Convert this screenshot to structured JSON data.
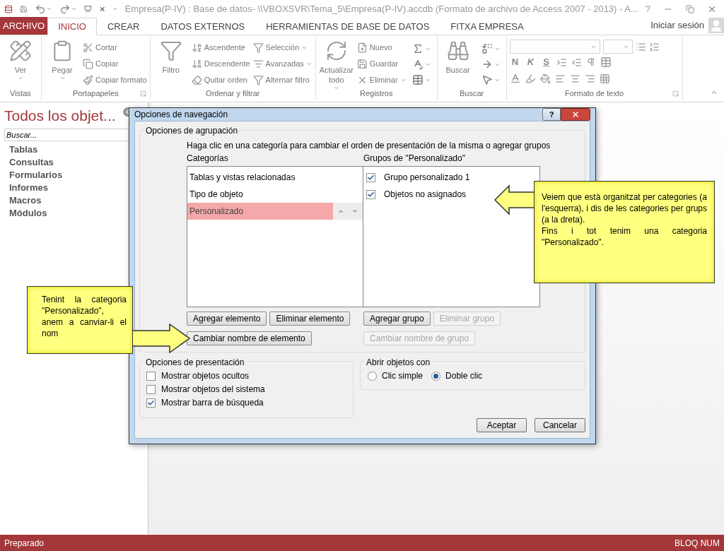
{
  "title_bar": {
    "title": "Empresa(P-IV) : Base de datos- \\\\VBOXSVR\\Tema_5\\Empresa(P-IV).accdb (Formato de archivo de Access 2007 - 2013) - A...",
    "help": "?"
  },
  "tabs": [
    {
      "label": "ARCHIVO",
      "kind": "file",
      "selected": false
    },
    {
      "label": "INICIO",
      "kind": "tab",
      "selected": true
    },
    {
      "label": "CREAR",
      "kind": "tab",
      "selected": false
    },
    {
      "label": "DATOS EXTERNOS",
      "kind": "tab",
      "selected": false
    },
    {
      "label": "HERRAMIENTAS DE BASE DE DATOS",
      "kind": "tab",
      "selected": false
    },
    {
      "label": "FITXA EMPRESA",
      "kind": "tab",
      "selected": false
    }
  ],
  "account": "Iniciar sesión",
  "ribbon": [
    {
      "label": "Vistas",
      "large": [
        {
          "label": "Ver",
          "dropdown": true
        }
      ]
    },
    {
      "label": "Portapapeles",
      "launcher": true,
      "large": [
        {
          "label": "Pegar",
          "dropdown": true
        }
      ],
      "columns": [
        [
          {
            "label": "Cortar",
            "dropdown": false
          },
          {
            "label": "Copiar",
            "dropdown": false
          },
          {
            "label": "Copiar formato",
            "dropdown": false
          }
        ]
      ]
    },
    {
      "label": "Ordenar y filtrar",
      "large": [
        {
          "label": "Filtro",
          "dropdown": false
        }
      ],
      "columns": [
        [
          {
            "label": "Ascendente",
            "dropdown": false
          },
          {
            "label": "Descendente",
            "dropdown": false
          },
          {
            "label": "Quitar orden",
            "dropdown": false
          }
        ],
        [
          {
            "label": "Selección",
            "dropdown": true
          },
          {
            "label": "Avanzadas",
            "dropdown": true
          },
          {
            "label": "Alternar filtro",
            "dropdown": false
          }
        ]
      ]
    },
    {
      "label": "Registros",
      "large": [
        {
          "label": "Actualizar todo",
          "dropdown": true
        }
      ],
      "columns": [
        [
          {
            "label": "Nuevo",
            "dropdown": false
          },
          {
            "label": "Guardar",
            "dropdown": false
          },
          {
            "label": "Eliminar",
            "dropdown": true
          }
        ]
      ]
    },
    {
      "label": "Buscar",
      "large": [
        {
          "label": "Buscar",
          "dropdown": false
        }
      ]
    },
    {
      "label": "Formato de texto",
      "launcher": true,
      "format_buttons": [
        "N",
        "K",
        "S"
      ]
    }
  ],
  "nav_pane": {
    "title": "Todos los objet...",
    "search_placeholder": "Buscar...",
    "items": [
      "Tablas",
      "Consultas",
      "Formularios",
      "Informes",
      "Macros",
      "Módulos"
    ]
  },
  "dialog": {
    "title": "Opciones de navegación",
    "help": "?",
    "grouping": {
      "legend": "Opciones de agrupación",
      "instruction": "Haga clic en una categoría para cambiar el orden de presentación de la misma o agregar grupos",
      "categories_label": "Categorías",
      "groups_label": "Grupos de \"Personalizado\"",
      "categories": [
        {
          "label": "Tablas y vistas relacionadas",
          "selected": false
        },
        {
          "label": "Tipo de objeto",
          "selected": false
        },
        {
          "label": "Personalizado",
          "selected": true
        }
      ],
      "groups": [
        {
          "label": "Grupo personalizado 1",
          "checked": true
        },
        {
          "label": "Objetos no asignados",
          "checked": true
        }
      ],
      "category_buttons": [
        {
          "label": "Agregar elemento",
          "disabled": false
        },
        {
          "label": "Eliminar elemento",
          "disabled": false
        },
        {
          "label": "Cambiar nombre de elemento",
          "disabled": false
        }
      ],
      "group_buttons": [
        {
          "label": "Agregar grupo",
          "disabled": false
        },
        {
          "label": "Eliminar grupo",
          "disabled": true
        },
        {
          "label": "Cambiar nombre de grupo",
          "disabled": true
        }
      ]
    },
    "display": {
      "legend": "Opciones de presentación",
      "options": [
        {
          "label": "Mostrar objetos ocultos",
          "checked": false
        },
        {
          "label": "Mostrar objetos del sistema",
          "checked": false
        },
        {
          "label": "Mostrar barra de búsqueda",
          "checked": true
        }
      ]
    },
    "open_with": {
      "legend": "Abrir objetos con",
      "options": [
        {
          "label": "Clic simple",
          "selected": false
        },
        {
          "label": "Doble clic",
          "selected": true
        }
      ]
    },
    "buttons": [
      "Aceptar",
      "Cancelar"
    ]
  },
  "callouts": [
    {
      "text": "Veiem que està organitzat per categories (a l'esquerra), i dis de les categories per grups (a la dreta).\nFins i tot tenim una categoria \"Personalizado\".",
      "kind": "left-arrow"
    },
    {
      "text": "Tenint la categoria \"Personalizado\", anem a canviar-li el nom",
      "kind": "right-arrow"
    }
  ],
  "status_bar": {
    "left": "Preparado",
    "right": "BLOQ NUM"
  }
}
